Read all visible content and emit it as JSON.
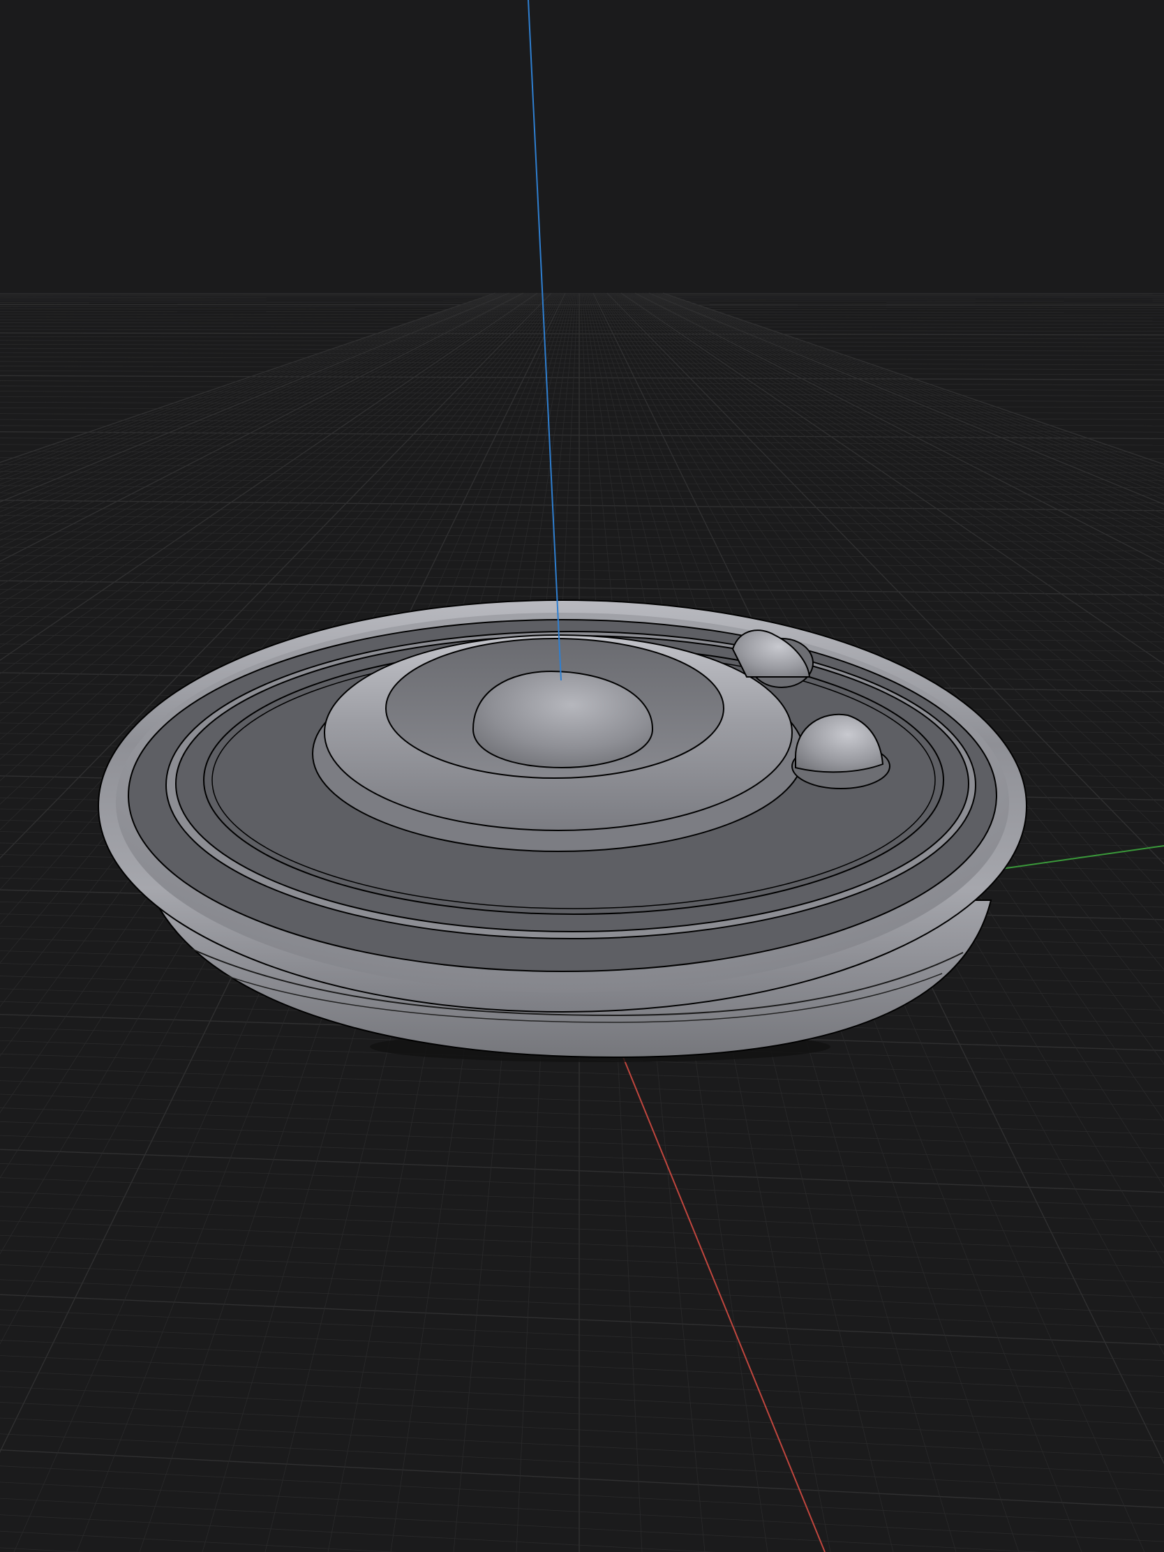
{
  "viewport": {
    "background": "#1b1b1c",
    "grid_minor_color": "#2a2a2b",
    "grid_major_color": "#303031"
  },
  "axes": {
    "x_axis_color": "#c0463e",
    "y_axis_color": "#3a9a3a",
    "z_axis_color": "#2f7fd0"
  },
  "model": {
    "name": "disc-model",
    "base_color": "#9a9ba1",
    "top_color": "#5e5f64",
    "edge_color": "#000000"
  }
}
